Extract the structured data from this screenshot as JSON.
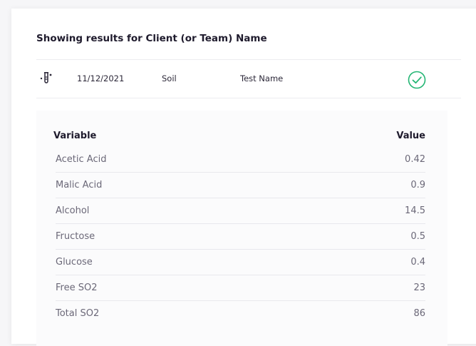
{
  "header": {
    "title": "Showing results for Client (or Team) Name"
  },
  "result": {
    "icon": "test-tube-icon",
    "date": "11/12/2021",
    "type": "Soil",
    "name": "Test Name",
    "status_icon": "check-circle-icon",
    "status_color": "#22b573"
  },
  "table": {
    "headers": {
      "variable": "Variable",
      "value": "Value"
    },
    "rows": [
      {
        "variable": "Acetic Acid",
        "value": "0.42"
      },
      {
        "variable": "Malic Acid",
        "value": "0.9"
      },
      {
        "variable": "Alcohol",
        "value": "14.5"
      },
      {
        "variable": "Fructose",
        "value": "0.5"
      },
      {
        "variable": "Glucose",
        "value": "0.4"
      },
      {
        "variable": "Free SO2",
        "value": "23"
      },
      {
        "variable": "Total SO2",
        "value": "86"
      }
    ]
  }
}
